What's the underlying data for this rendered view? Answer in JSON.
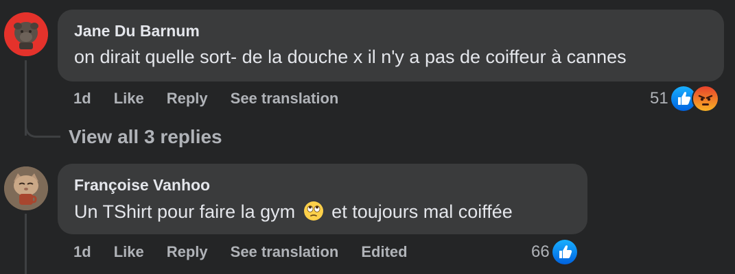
{
  "comments": [
    {
      "author": "Jane Du Barnum",
      "text": "on dirait quelle sort- de la douche x il n'y a pas de coiffeur à cannes",
      "time": "1d",
      "like_label": "Like",
      "reply_label": "Reply",
      "translate_label": "See translation",
      "reaction_count": "51",
      "reactions": [
        "like-icon",
        "angry-icon"
      ],
      "avatar": "bulldog-statue-avatar"
    },
    {
      "author": "Françoise Vanhoo",
      "text_before_emoji": "Un TShirt pour faire la gym",
      "text_after_emoji": "et toujours mal coiffée",
      "emoji": "eye-roll-emoji",
      "time": "1d",
      "like_label": "Like",
      "reply_label": "Reply",
      "translate_label": "See translation",
      "edited_label": "Edited",
      "reaction_count": "66",
      "reactions": [
        "like-icon"
      ],
      "avatar": "cat-with-mug-avatar"
    }
  ],
  "view_replies_label": "View all 3 replies",
  "colors": {
    "background": "#242526",
    "bubble": "#3a3b3c",
    "primary_text": "#e4e6eb",
    "secondary_text": "#b0b3b8",
    "like_blue": "#1877f2",
    "angry_orange": "#f05a28"
  }
}
